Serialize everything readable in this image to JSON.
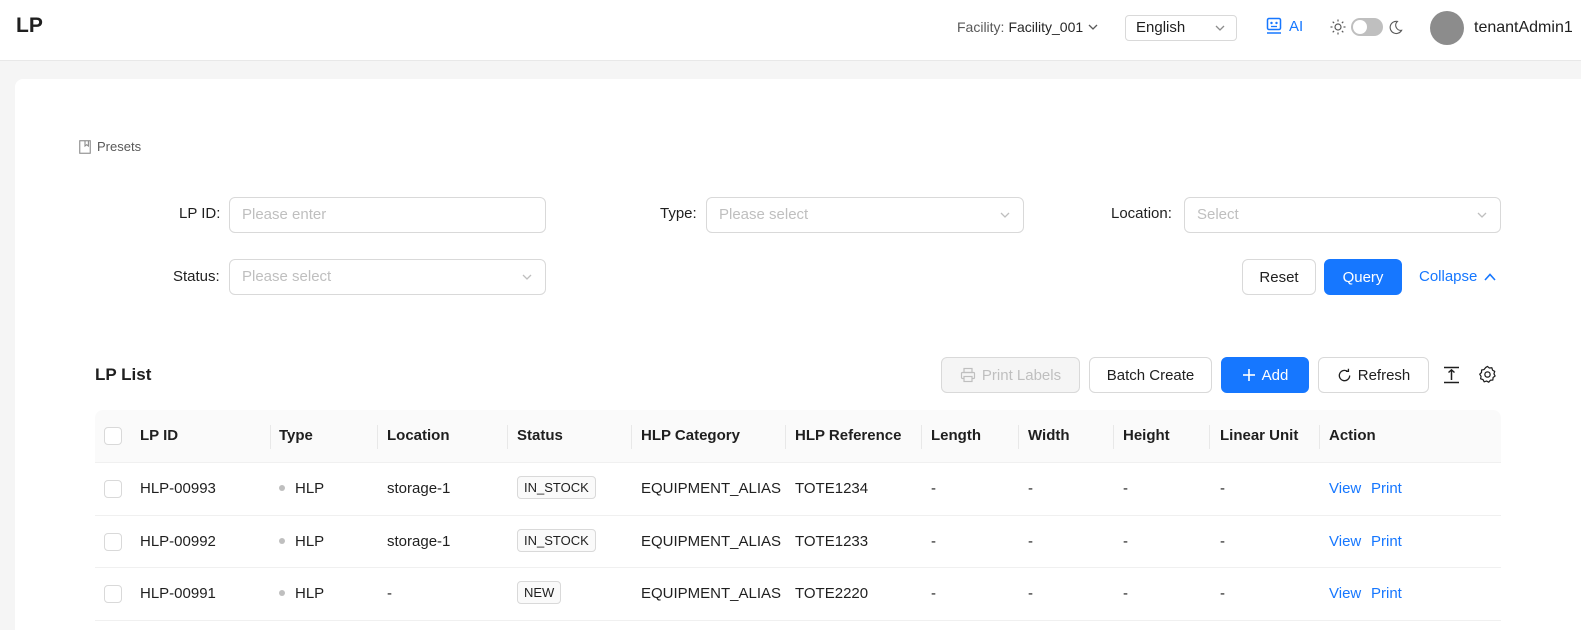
{
  "header": {
    "title": "LP",
    "facility_label": "Facility:",
    "facility_value": "Facility_001",
    "language": "English",
    "ai_label": "AI",
    "username": "tenantAdmin1"
  },
  "presets_label": "Presets",
  "filters": {
    "lp_id": {
      "label": "LP ID",
      "placeholder": "Please enter"
    },
    "type": {
      "label": "Type",
      "placeholder": "Please select"
    },
    "location": {
      "label": "Location",
      "placeholder": "Select"
    },
    "status": {
      "label": "Status",
      "placeholder": "Please select"
    },
    "reset_label": "Reset",
    "query_label": "Query",
    "collapse_label": "Collapse"
  },
  "list": {
    "title": "LP List",
    "print_labels": "Print Labels",
    "batch_create": "Batch Create",
    "add": "Add",
    "refresh": "Refresh"
  },
  "table": {
    "columns": [
      "LP ID",
      "Type",
      "Location",
      "Status",
      "HLP Category",
      "HLP Reference",
      "Length",
      "Width",
      "Height",
      "Linear Unit",
      "Action"
    ],
    "rows": [
      {
        "lp_id": "HLP-00993",
        "type": "HLP",
        "location": "storage-1",
        "status": "IN_STOCK",
        "category": "EQUIPMENT_ALIAS",
        "reference": "TOTE1234",
        "length": "-",
        "width": "-",
        "height": "-",
        "unit": "-",
        "view": "View",
        "print": "Print"
      },
      {
        "lp_id": "HLP-00992",
        "type": "HLP",
        "location": "storage-1",
        "status": "IN_STOCK",
        "category": "EQUIPMENT_ALIAS",
        "reference": "TOTE1233",
        "length": "-",
        "width": "-",
        "height": "-",
        "unit": "-",
        "view": "View",
        "print": "Print"
      },
      {
        "lp_id": "HLP-00991",
        "type": "HLP",
        "location": "-",
        "status": "NEW",
        "category": "EQUIPMENT_ALIAS",
        "reference": "TOTE2220",
        "length": "-",
        "width": "-",
        "height": "-",
        "unit": "-",
        "view": "View",
        "print": "Print"
      }
    ]
  },
  "colors": {
    "primary": "#1677ff"
  }
}
